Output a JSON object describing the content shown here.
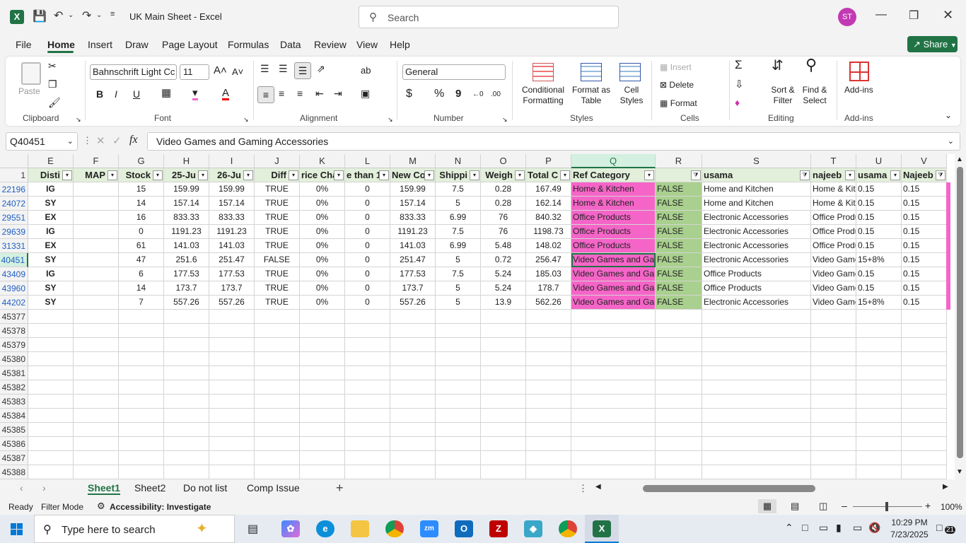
{
  "titlebar": {
    "autosave_label": "",
    "doc_title": "UK Main Sheet  -  Excel",
    "search_placeholder": "Search",
    "user_initials": "ST"
  },
  "menu": [
    "File",
    "Home",
    "Insert",
    "Draw",
    "Page Layout",
    "Formulas",
    "Data",
    "Review",
    "View",
    "Help"
  ],
  "share_label": "Share",
  "ribbon": {
    "clipboard": {
      "paste": "Paste",
      "label": "Clipboard"
    },
    "font": {
      "family": "Bahnschrift Light Cc",
      "size": "11",
      "label": "Font",
      "bold": "B",
      "italic": "I",
      "underline": "U"
    },
    "alignment": {
      "label": "Alignment"
    },
    "number": {
      "format": "General",
      "label": "Number",
      "currency": "$",
      "percent": "%",
      "comma": "9"
    },
    "styles": {
      "conditional": "Conditional",
      "conditional2": "Formatting",
      "format_as": "Format as",
      "format_as2": "Table",
      "cell": "Cell",
      "cell2": "Styles",
      "label": "Styles"
    },
    "cells": {
      "insert": "Insert",
      "delete": "Delete",
      "format": "Format",
      "label": "Cells"
    },
    "editing": {
      "sort": "Sort &",
      "sort2": "Filter",
      "find": "Find &",
      "find2": "Select",
      "label": "Editing"
    },
    "addins": {
      "btn": "Add-ins",
      "label": "Add-ins"
    }
  },
  "formula_bar": {
    "name_box": "Q40451",
    "fx": "fx",
    "content": "Video Games and Gaming Accessories"
  },
  "columns": [
    "E",
    "F",
    "G",
    "H",
    "I",
    "J",
    "K",
    "L",
    "M",
    "N",
    "O",
    "P",
    "Q",
    "R",
    "S",
    "T",
    "U",
    "V"
  ],
  "header_row": {
    "num": "1",
    "cells": [
      "Disti",
      "MAP",
      "Stock",
      "25-Ju",
      "26-Ju",
      "Diff",
      "rice Cha",
      "e than 1",
      "New Co",
      "Shippi",
      "Weigh",
      "Total C",
      "Ref Category",
      "",
      "usama",
      "najeeb",
      "usama",
      "Najeeb"
    ]
  },
  "rows": [
    {
      "num": "22196",
      "cells": [
        "IG",
        "",
        "15",
        "159.99",
        "159.99",
        "TRUE",
        "0%",
        "0",
        "159.99",
        "7.5",
        "0.28",
        "167.49",
        "Home & Kitchen",
        "FALSE",
        "Home and Kitchen",
        "Home & Kitc",
        "0.15",
        "0.15"
      ]
    },
    {
      "num": "24072",
      "cells": [
        "SY",
        "",
        "14",
        "157.14",
        "157.14",
        "TRUE",
        "0%",
        "0",
        "157.14",
        "5",
        "0.28",
        "162.14",
        "Home & Kitchen",
        "FALSE",
        "Home and Kitchen",
        "Home & Kitc",
        "0.15",
        "0.15"
      ]
    },
    {
      "num": "29551",
      "cells": [
        "EX",
        "",
        "16",
        "833.33",
        "833.33",
        "TRUE",
        "0%",
        "0",
        "833.33",
        "6.99",
        "76",
        "840.32",
        "Office Products",
        "FALSE",
        "Electronic Accessories",
        "Office Produ",
        "0.15",
        "0.15"
      ]
    },
    {
      "num": "29639",
      "cells": [
        "IG",
        "",
        "0",
        "1191.23",
        "1191.23",
        "TRUE",
        "0%",
        "0",
        "1191.23",
        "7.5",
        "76",
        "1198.73",
        "Office Products",
        "FALSE",
        "Electronic Accessories",
        "Office Produ",
        "0.15",
        "0.15"
      ]
    },
    {
      "num": "31331",
      "cells": [
        "EX",
        "",
        "61",
        "141.03",
        "141.03",
        "TRUE",
        "0%",
        "0",
        "141.03",
        "6.99",
        "5.48",
        "148.02",
        "Office Products",
        "FALSE",
        "Electronic Accessories",
        "Office Produ",
        "0.15",
        "0.15"
      ]
    },
    {
      "num": "40451",
      "cells": [
        "SY",
        "",
        "47",
        "251.6",
        "251.47",
        "FALSE",
        "0%",
        "0",
        "251.47",
        "5",
        "0.72",
        "256.47",
        "Video Games and Gamin",
        "FALSE",
        "Electronic Accessories",
        "Video Games",
        "15+8%",
        "0.15"
      ]
    },
    {
      "num": "43409",
      "cells": [
        "IG",
        "",
        "6",
        "177.53",
        "177.53",
        "TRUE",
        "0%",
        "0",
        "177.53",
        "7.5",
        "5.24",
        "185.03",
        "Video Games and Gamin",
        "FALSE",
        "Office Products",
        "Video Games",
        "0.15",
        "0.15"
      ]
    },
    {
      "num": "43960",
      "cells": [
        "SY",
        "",
        "14",
        "173.7",
        "173.7",
        "TRUE",
        "0%",
        "0",
        "173.7",
        "5",
        "5.24",
        "178.7",
        "Video Games and Gamin",
        "FALSE",
        "Office Products",
        "Video Games",
        "0.15",
        "0.15"
      ]
    },
    {
      "num": "44202",
      "cells": [
        "SY",
        "",
        "7",
        "557.26",
        "557.26",
        "TRUE",
        "0%",
        "0",
        "557.26",
        "5",
        "13.9",
        "562.26",
        "Video Games and Gamin",
        "FALSE",
        "Electronic Accessories",
        "Video Games",
        "15+8%",
        "0.15"
      ]
    }
  ],
  "empty_rows": [
    "45377",
    "45378",
    "45379",
    "45380",
    "45381",
    "45382",
    "45383",
    "45384",
    "45385",
    "45386",
    "45387",
    "45388"
  ],
  "sheets": [
    "Sheet1",
    "Sheet2",
    "Do not list",
    "Comp Issue"
  ],
  "status": {
    "ready": "Ready",
    "mode": "Filter Mode",
    "accessibility": "Accessibility: Investigate",
    "zoom": "100%"
  },
  "taskbar": {
    "search": "Type here to search",
    "time": "10:29 PM",
    "date": "7/23/2025",
    "badge": "21"
  },
  "colors": {
    "pink": "#f565c8",
    "green": "#a9d08e",
    "excel_green": "#217346",
    "header_green": "#e2efda"
  }
}
